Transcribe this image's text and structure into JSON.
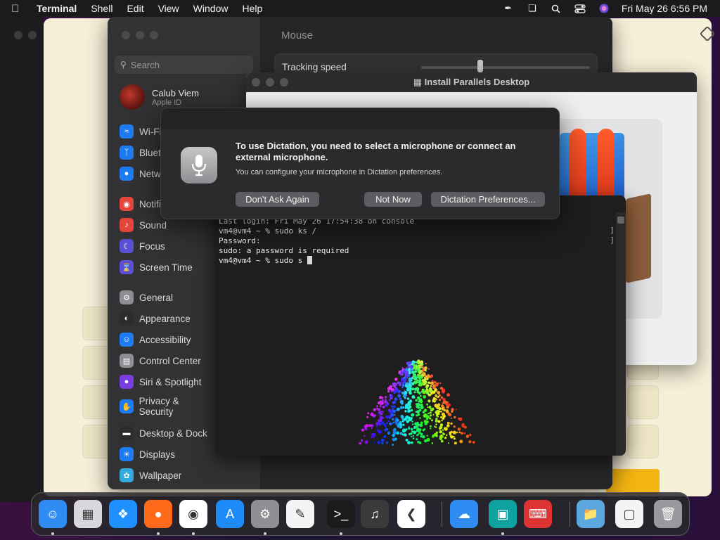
{
  "menubar": {
    "apple_icon": "apple-logo-icon",
    "items": [
      "Terminal",
      "Shell",
      "Edit",
      "View",
      "Window",
      "Help"
    ],
    "clock": "Fri May 26  6:56 PM",
    "status_icons": [
      "pen-icon",
      "window-switch-icon",
      "search-icon",
      "control-center-icon",
      "siri-icon"
    ]
  },
  "settings": {
    "search_placeholder": "Search",
    "account_name": "Calub Viem",
    "account_sub": "Apple ID",
    "sidebar": [
      {
        "label": "Wi-Fi",
        "icon": "wifi-icon",
        "color": "#1e7cf2"
      },
      {
        "label": "Bluetooth",
        "icon": "bluetooth-icon",
        "color": "#1e7cf2"
      },
      {
        "label": "Network",
        "icon": "globe-icon",
        "color": "#1e7cf2"
      },
      {
        "label": "Notifications",
        "icon": "bell-icon",
        "color": "#e5453a"
      },
      {
        "label": "Sound",
        "icon": "speaker-icon",
        "color": "#e5453a"
      },
      {
        "label": "Focus",
        "icon": "moon-icon",
        "color": "#5b4fd6"
      },
      {
        "label": "Screen Time",
        "icon": "hourglass-icon",
        "color": "#5b4fd6"
      },
      {
        "label": "General",
        "icon": "gear-icon",
        "color": "#8e8e93"
      },
      {
        "label": "Appearance",
        "icon": "appearance-icon",
        "color": "#2c2c2e"
      },
      {
        "label": "Accessibility",
        "icon": "accessibility-icon",
        "color": "#1e7cf2"
      },
      {
        "label": "Control Center",
        "icon": "control-center-icon",
        "color": "#8e8e93"
      },
      {
        "label": "Siri & Spotlight",
        "icon": "siri-icon",
        "color": "#7a3de0"
      },
      {
        "label": "Privacy & Security",
        "icon": "hand-icon",
        "color": "#1e7cf2"
      },
      {
        "label": "Desktop & Dock",
        "icon": "dock-icon",
        "color": "#2c2c2e"
      },
      {
        "label": "Displays",
        "icon": "sun-icon",
        "color": "#1e7cf2"
      },
      {
        "label": "Wallpaper",
        "icon": "wallpaper-icon",
        "color": "#34aadc"
      }
    ],
    "content_title": "Mouse",
    "tracking_label": "Tracking speed",
    "tracking_value": 0.35
  },
  "installer": {
    "title": "Install Parallels Desktop"
  },
  "terminal": {
    "lines": [
      "Last login: Fri May 26 17:54:38 on console",
      "vm4@vm4 ~ % sudo ks /",
      "Password:",
      "sudo: a password is required",
      "vm4@vm4 ~ % sudo s "
    ]
  },
  "alert": {
    "title": "To use Dictation, you need to select a microphone or connect an external microphone.",
    "body": "You can configure your microphone in Dictation preferences.",
    "btn_dont_ask": "Don't Ask Again",
    "btn_not_now": "Not Now",
    "btn_prefs": "Dictation Preferences..."
  },
  "dock": {
    "apps": [
      {
        "name": "Finder",
        "icon": "finder-icon",
        "color": "#2f8cf3"
      },
      {
        "name": "Launchpad",
        "icon": "launchpad-icon",
        "color": "#d8d8dc"
      },
      {
        "name": "Safari",
        "icon": "safari-icon",
        "color": "#1e90ff"
      },
      {
        "name": "Firefox",
        "icon": "firefox-icon",
        "color": "#ff6a1a"
      },
      {
        "name": "Chrome",
        "icon": "chrome-icon",
        "color": "#ffffff"
      },
      {
        "name": "App Store",
        "icon": "app-store-icon",
        "color": "#1d8cf8"
      },
      {
        "name": "System Settings",
        "icon": "settings-icon",
        "color": "#8e8e93"
      },
      {
        "name": "TextEdit",
        "icon": "textedit-icon",
        "color": "#f4f4f4"
      },
      {
        "name": "Terminal",
        "icon": "terminal-icon",
        "color": "#1b1b1b"
      },
      {
        "name": "GarageBand",
        "icon": "guitar-icon",
        "color": "#3a3a3a"
      },
      {
        "name": "VS Code",
        "icon": "vscode-icon",
        "color": "#ffffff"
      },
      {
        "name": "Weather",
        "icon": "weather-icon",
        "color": "#2f8cf3"
      },
      {
        "name": "Parallels",
        "icon": "parallels-icon",
        "color": "#0fa3a0"
      },
      {
        "name": "Input Keyboard",
        "icon": "keyboard-icon",
        "color": "#d33"
      },
      {
        "name": "Downloads",
        "icon": "folder-icon",
        "color": "#5ba8e0"
      },
      {
        "name": "Screenshot",
        "icon": "screenshot-icon",
        "color": "#f4f4f4"
      },
      {
        "name": "Trash",
        "icon": "trash-icon",
        "color": "#9a9a9e"
      }
    ]
  }
}
